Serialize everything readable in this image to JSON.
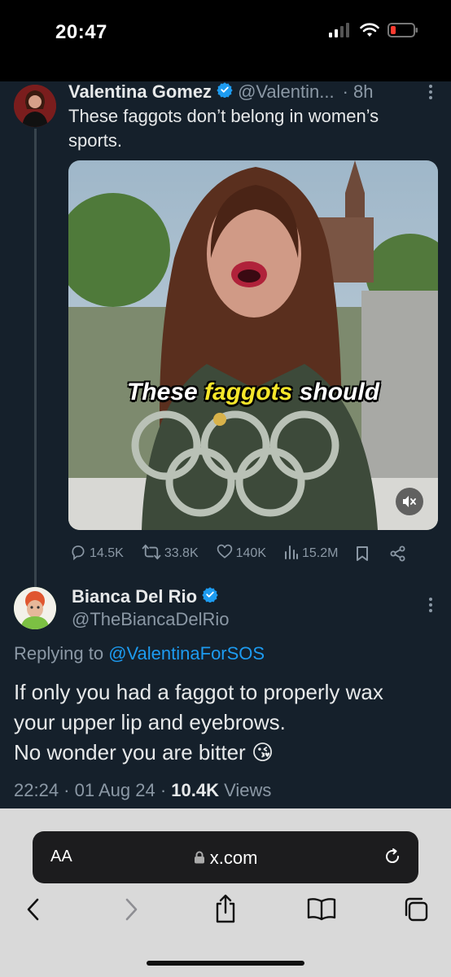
{
  "status": {
    "time": "20:47"
  },
  "tweet1": {
    "name": "Valentina Gomez",
    "handle": "@Valentin...",
    "time": "· 8h",
    "text": "These faggots don’t belong in women’s sports.",
    "caption_before": "These ",
    "caption_highlight": "faggots",
    "caption_after": " should",
    "stats": {
      "replies": "14.5K",
      "reposts": "33.8K",
      "likes": "140K",
      "views": "15.2M"
    }
  },
  "tweet2": {
    "name": "Bianca Del Rio",
    "handle": "@TheBiancaDelRio",
    "replying_prefix": "Replying to ",
    "replying_to": "@ValentinaForSOS",
    "text_line1": "If only you had a faggot to properly wax",
    "text_line2": "your upper lip and eyebrows.",
    "text_line3": "No wonder you are bitter",
    "emoji": "😘",
    "time": "22:24",
    "date": "01 Aug 24",
    "views_count": "10.4K",
    "views_label": "Views"
  },
  "browser": {
    "aa": "AA",
    "url": "x.com"
  },
  "colors": {
    "background": "#15202b",
    "accent": "#1d9bf0",
    "muted": "#8b98a5"
  },
  "icons": [
    "signal-icon",
    "wifi-icon",
    "battery-icon",
    "verified-badge-icon",
    "more-icon",
    "mute-icon",
    "reply-icon",
    "repost-icon",
    "like-icon",
    "views-icon",
    "bookmark-icon",
    "share-icon",
    "lock-icon",
    "reload-icon",
    "back-icon",
    "forward-icon",
    "share-sheet-icon",
    "bookmarks-icon",
    "tabs-icon"
  ]
}
